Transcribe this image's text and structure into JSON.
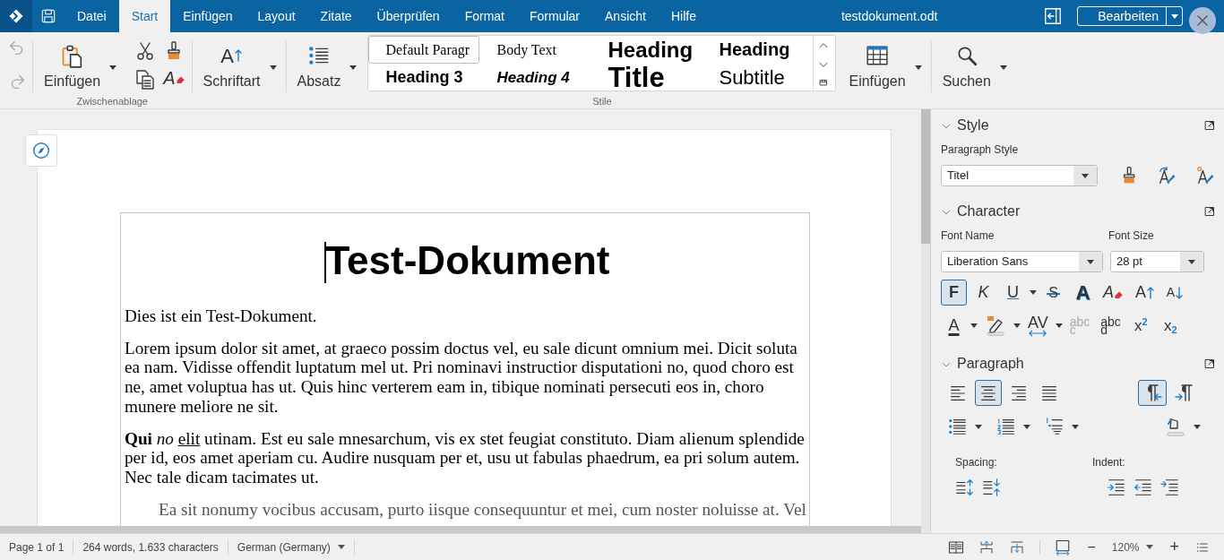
{
  "app": {
    "title": "testdokument.odt",
    "edit_button": "Bearbeiten"
  },
  "menu_tabs": [
    {
      "label": "Datei",
      "selected": false
    },
    {
      "label": "Start",
      "selected": true
    },
    {
      "label": "Einfügen",
      "selected": false
    },
    {
      "label": "Layout",
      "selected": false
    },
    {
      "label": "Zitate",
      "selected": false
    },
    {
      "label": "Überprüfen",
      "selected": false
    },
    {
      "label": "Format",
      "selected": false
    },
    {
      "label": "Formular",
      "selected": false
    },
    {
      "label": "Ansicht",
      "selected": false
    },
    {
      "label": "Hilfe",
      "selected": false
    }
  ],
  "ribbon": {
    "history": [
      {
        "kind": "undo",
        "disabled": true
      },
      {
        "kind": "redo",
        "disabled": true
      }
    ],
    "clipboard": {
      "label": "Zwischenablage",
      "paste": "Einfügen",
      "clear_glyph": "A"
    },
    "font": {
      "label": "Schriftart",
      "glyph": "A"
    },
    "paragraph": {
      "label": "Absatz"
    },
    "styles": {
      "label": "Stile",
      "items": [
        {
          "label": "Default Paragr",
          "kind": "default",
          "selected": true
        },
        {
          "label": "Body Text",
          "kind": "body",
          "selected": false
        },
        {
          "label": "Heading",
          "kind": "h1",
          "selected": false
        },
        {
          "label": "Heading",
          "kind": "h2",
          "selected": false
        },
        {
          "label": "Heading 3",
          "kind": "h3",
          "selected": false
        },
        {
          "label": "Heading 4",
          "kind": "h4",
          "selected": false
        },
        {
          "label": "Title",
          "kind": "title",
          "selected": false
        },
        {
          "label": "Subtitle",
          "kind": "subtitle",
          "selected": false
        }
      ]
    },
    "table": {
      "label": "Einfügen"
    },
    "search": {
      "label": "Suchen"
    }
  },
  "document": {
    "title": "Test-Dokument",
    "cursor": true,
    "paragraphs": [
      {
        "kind": "plain",
        "runs": [
          {
            "text": "Dies ist ein Test-Dokument."
          }
        ]
      },
      {
        "kind": "plain",
        "runs": [
          {
            "text": "Lorem ipsum dolor sit amet, at graeco possim doctus vel, eu sale dicunt omnium mei. Dicit soluta ea nam. Vidisse offendit luptatum mel ut. Pri nominavi instructior disputationi no, quod choro est ne, amet voluptua has ut. Quis hinc verterem eam in, tibique nominati persecuti eos in, choro munere meliore ne sit."
          }
        ]
      },
      {
        "kind": "plain",
        "runs": [
          {
            "text": "Qui",
            "kind": "bold"
          },
          {
            "text": "no",
            "kind": "italic"
          },
          {
            "text": "elit",
            "kind": "underline"
          },
          {
            "text": "utinam. Est eu sale mnesarchum, vis ex stet feugiat constituto. Diam alienum splendide per id, eos amet aperiam cu. Audire nusquam per et, usu ut fabulas phaedrum, ea pri solum autem. Nec tale dicam tacimates ut."
          }
        ]
      },
      {
        "kind": "indented",
        "runs": [
          {
            "text": "Ea sit nonumy vocibus accusam, purto iisque consequuntur et mei, cum noster noluisse at. Vel"
          }
        ]
      }
    ]
  },
  "sidebar": {
    "style": {
      "title": "Style",
      "expanded": true,
      "paragraph_style_label": "Paragraph Style",
      "paragraph_style": "Titel"
    },
    "character": {
      "title": "Character",
      "expanded": true,
      "font_name_label": "Font Name",
      "font_name": "Liberation Sans",
      "font_size_label": "Font Size",
      "font_size": "28 pt",
      "row1": [
        {
          "kind": "bold",
          "glyph": "F",
          "selected": true
        },
        {
          "kind": "italic",
          "glyph": "K",
          "selected": false
        },
        {
          "kind": "underline",
          "glyph": "U",
          "selected": false
        },
        {
          "kind": "strike",
          "glyph": "S",
          "selected": false
        },
        {
          "kind": "shadow",
          "glyph": "A",
          "selected": false
        },
        {
          "kind": "clear",
          "glyph": "A"
        },
        {
          "kind": "grow",
          "glyph": "A"
        },
        {
          "kind": "shrink",
          "glyph": "A"
        }
      ],
      "row2": [
        {
          "kind": "color",
          "glyph": "A"
        },
        {
          "kind": "highlight"
        },
        {
          "kind": "spacing",
          "glyph": "AV"
        },
        {
          "kind": "case",
          "glyph": "abc",
          "glyph2": "c",
          "disabled": true
        },
        {
          "kind": "wrap",
          "glyph": "abc",
          "glyph2": "d",
          "disabled": false
        },
        {
          "kind": "superscript",
          "glyph": "x$^{2}$",
          "selected": false
        },
        {
          "kind": "subscript",
          "glyph": "x$_{2}$",
          "selected": false
        }
      ]
    },
    "paragraph": {
      "title": "Paragraph",
      "expanded": true,
      "align": [
        {
          "kind": "left",
          "selected": false
        },
        {
          "kind": "center",
          "selected": true
        },
        {
          "kind": "right",
          "selected": false
        },
        {
          "kind": "justify",
          "selected": false
        }
      ],
      "direction": [
        {
          "kind": "ltr",
          "selected": true
        },
        {
          "kind": "rtl",
          "selected": false
        }
      ],
      "spacing_label": "Spacing:",
      "indent_label": "Indent:"
    }
  },
  "status_bar": {
    "page": "Page 1 of 1",
    "words": "264 words, 1.633 characters",
    "language": "German (Germany)",
    "zoom_out": "−",
    "zoom": "120%",
    "zoom_in": "+"
  }
}
